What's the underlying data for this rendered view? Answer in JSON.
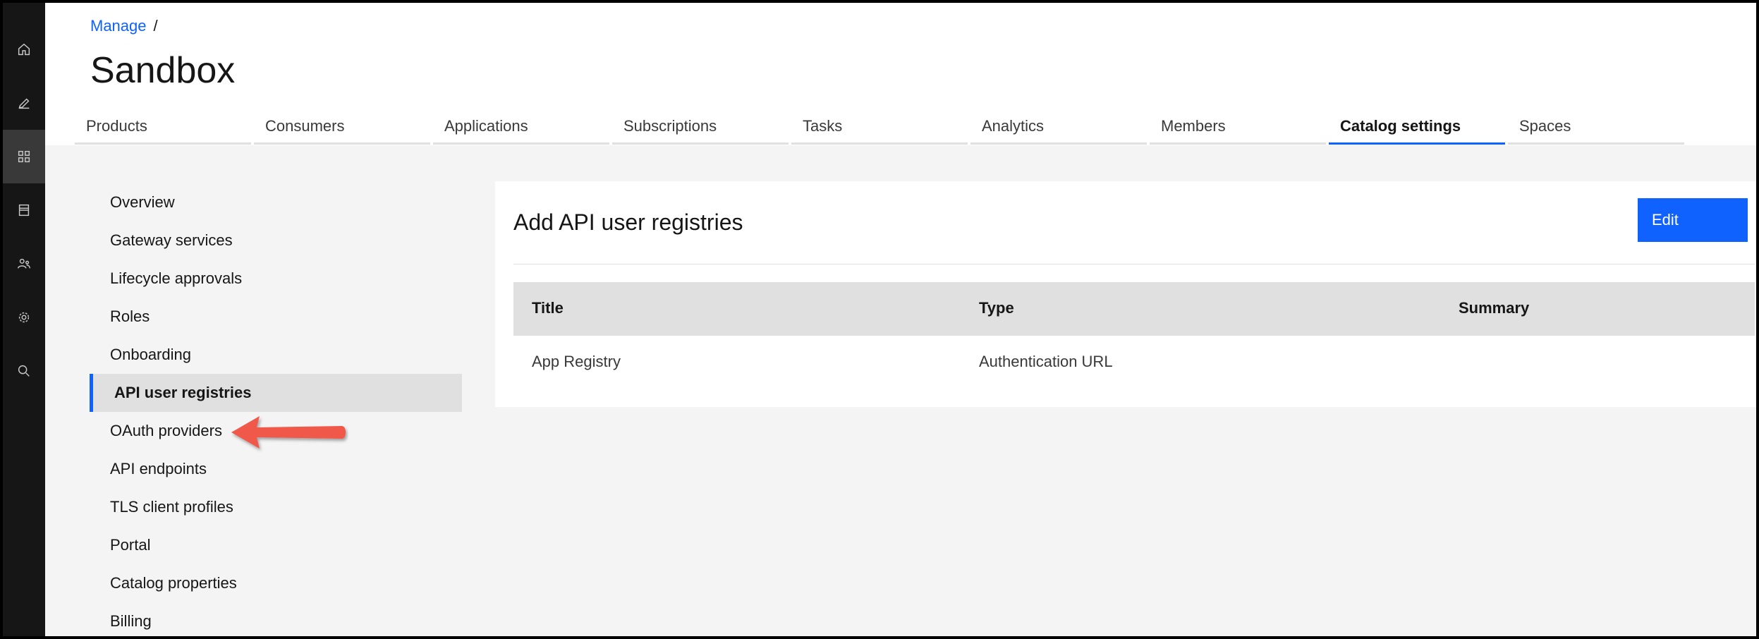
{
  "breadcrumb": {
    "link": "Manage",
    "separator": "/"
  },
  "page_title": "Sandbox",
  "tabs": [
    {
      "label": "Products"
    },
    {
      "label": "Consumers"
    },
    {
      "label": "Applications"
    },
    {
      "label": "Subscriptions"
    },
    {
      "label": "Tasks"
    },
    {
      "label": "Analytics"
    },
    {
      "label": "Members"
    },
    {
      "label": "Catalog settings",
      "active": true
    },
    {
      "label": "Spaces"
    }
  ],
  "rail_icons": [
    "home-icon",
    "edit-icon",
    "dashboard-icon",
    "archive-icon",
    "users-icon",
    "settings-icon",
    "search-icon"
  ],
  "sidenav": {
    "items": [
      {
        "label": "Overview"
      },
      {
        "label": "Gateway services"
      },
      {
        "label": "Lifecycle approvals"
      },
      {
        "label": "Roles"
      },
      {
        "label": "Onboarding"
      },
      {
        "label": "API user registries",
        "active": true
      },
      {
        "label": "OAuth providers"
      },
      {
        "label": "API endpoints"
      },
      {
        "label": "TLS client profiles"
      },
      {
        "label": "Portal"
      },
      {
        "label": "Catalog properties"
      },
      {
        "label": "Billing"
      }
    ]
  },
  "card": {
    "title": "Add API user registries",
    "edit_label": "Edit",
    "table": {
      "headers": [
        "Title",
        "Type",
        "Summary"
      ],
      "rows": [
        [
          "App Registry",
          "Authentication URL",
          ""
        ]
      ]
    }
  },
  "colors": {
    "accent": "#0f62fe",
    "rail": "#161616",
    "callout": "#f0584a"
  }
}
